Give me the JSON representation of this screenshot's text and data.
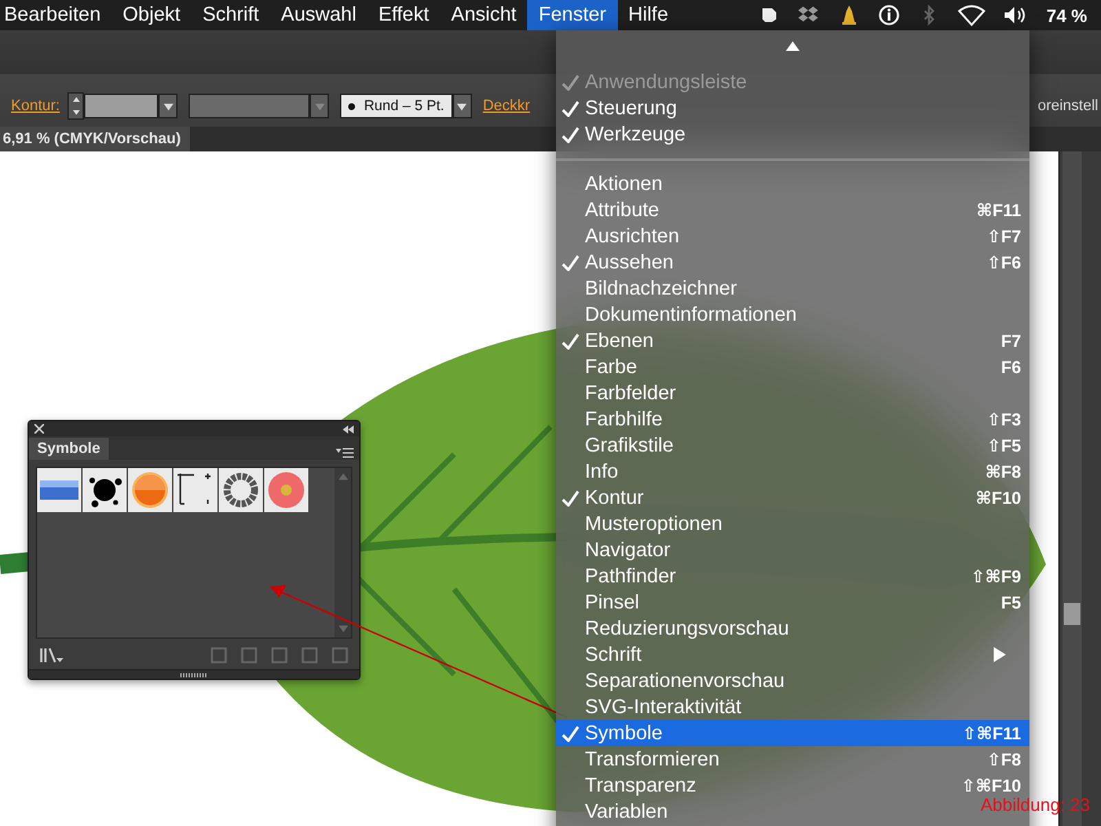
{
  "menu_bar": {
    "items": [
      {
        "label": "Bearbeiten",
        "selected": false
      },
      {
        "label": "Objekt",
        "selected": false
      },
      {
        "label": "Schrift",
        "selected": false
      },
      {
        "label": "Auswahl",
        "selected": false
      },
      {
        "label": "Effekt",
        "selected": false
      },
      {
        "label": "Ansicht",
        "selected": false
      },
      {
        "label": "Fenster",
        "selected": true
      },
      {
        "label": "Hilfe",
        "selected": false
      }
    ],
    "battery": "74 %"
  },
  "control_bar": {
    "stroke_label": "Kontur:",
    "brush": "Rund – 5 Pt.",
    "opacity_label": "Deckkr",
    "preset_label": "oreinstell"
  },
  "document_tab": {
    "title": "6,91 % (CMYK/Vorschau)"
  },
  "symbols_panel": {
    "tab": "Symbole"
  },
  "window_menu": {
    "sections": [
      {
        "items": [
          {
            "label": "Anwendungsleiste",
            "checked": true,
            "disabled": true,
            "selected": false
          },
          {
            "label": "Steuerung",
            "checked": true,
            "disabled": false,
            "selected": false
          },
          {
            "label": "Werkzeuge",
            "checked": true,
            "disabled": false,
            "selected": false
          }
        ]
      },
      {
        "items": [
          {
            "label": "Aktionen",
            "checked": false,
            "disabled": false,
            "selected": false
          },
          {
            "label": "Attribute",
            "checked": false,
            "disabled": false,
            "selected": false,
            "shortcut": "⌘F11"
          },
          {
            "label": "Ausrichten",
            "checked": false,
            "disabled": false,
            "selected": false,
            "shortcut": "⇧F7"
          },
          {
            "label": "Aussehen",
            "checked": true,
            "disabled": false,
            "selected": false,
            "shortcut": "⇧F6"
          },
          {
            "label": "Bildnachzeichner",
            "checked": false,
            "disabled": false,
            "selected": false
          },
          {
            "label": "Dokumentinformationen",
            "checked": false,
            "disabled": false,
            "selected": false
          },
          {
            "label": "Ebenen",
            "checked": true,
            "disabled": false,
            "selected": false,
            "shortcut": "F7"
          },
          {
            "label": "Farbe",
            "checked": false,
            "disabled": false,
            "selected": false,
            "shortcut": "F6"
          },
          {
            "label": "Farbfelder",
            "checked": false,
            "disabled": false,
            "selected": false
          },
          {
            "label": "Farbhilfe",
            "checked": false,
            "disabled": false,
            "selected": false,
            "shortcut": "⇧F3"
          },
          {
            "label": "Grafikstile",
            "checked": false,
            "disabled": false,
            "selected": false,
            "shortcut": "⇧F5"
          },
          {
            "label": "Info",
            "checked": false,
            "disabled": false,
            "selected": false,
            "shortcut": "⌘F8"
          },
          {
            "label": "Kontur",
            "checked": true,
            "disabled": false,
            "selected": false,
            "shortcut": "⌘F10"
          },
          {
            "label": "Musteroptionen",
            "checked": false,
            "disabled": false,
            "selected": false
          },
          {
            "label": "Navigator",
            "checked": false,
            "disabled": false,
            "selected": false
          },
          {
            "label": "Pathfinder",
            "checked": false,
            "disabled": false,
            "selected": false,
            "shortcut": "⇧⌘F9"
          },
          {
            "label": "Pinsel",
            "checked": false,
            "disabled": false,
            "selected": false,
            "shortcut": "F5"
          },
          {
            "label": "Reduzierungsvorschau",
            "checked": false,
            "disabled": false,
            "selected": false
          },
          {
            "label": "Schrift",
            "checked": false,
            "disabled": false,
            "selected": false,
            "submenu": true
          },
          {
            "label": "Separationenvorschau",
            "checked": false,
            "disabled": false,
            "selected": false
          },
          {
            "label": "SVG-Interaktivität",
            "checked": false,
            "disabled": false,
            "selected": false
          },
          {
            "label": "Symbole",
            "checked": true,
            "disabled": false,
            "selected": true,
            "shortcut": "⇧⌘F11"
          },
          {
            "label": "Transformieren",
            "checked": false,
            "disabled": false,
            "selected": false,
            "shortcut": "⇧F8"
          },
          {
            "label": "Transparenz",
            "checked": false,
            "disabled": false,
            "selected": false,
            "shortcut": "⇧⌘F10"
          },
          {
            "label": "Variablen",
            "checked": false,
            "disabled": false,
            "selected": false
          }
        ]
      }
    ]
  },
  "caption": "Abbildung: 23"
}
